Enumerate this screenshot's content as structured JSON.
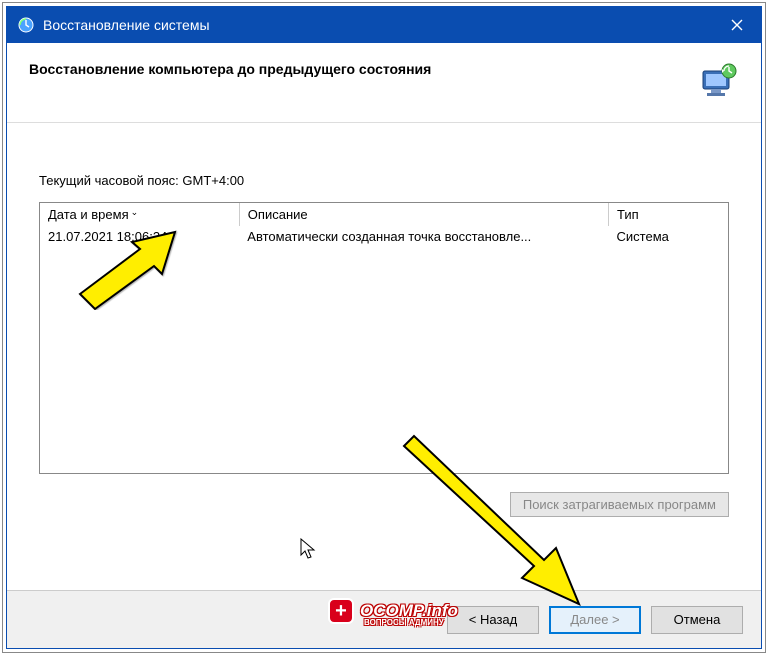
{
  "title": "Восстановление системы",
  "header": {
    "title": "Восстановление компьютера до предыдущего состояния"
  },
  "content": {
    "timezone_label": "Текущий часовой пояс: GMT+4:00",
    "columns": {
      "date": "Дата и время",
      "desc": "Описание",
      "type": "Тип"
    },
    "rows": [
      {
        "date": "21.07.2021 18:06:34",
        "desc": "Автоматически созданная точка восстановле...",
        "type": "Система"
      }
    ],
    "scan_button": "Поиск затрагиваемых программ"
  },
  "footer": {
    "back": "< Назад",
    "next": "Далее >",
    "cancel": "Отмена"
  },
  "watermark": {
    "main": "OCOMP.info",
    "sub": "ВОПРОСЫ АДМИНУ"
  }
}
